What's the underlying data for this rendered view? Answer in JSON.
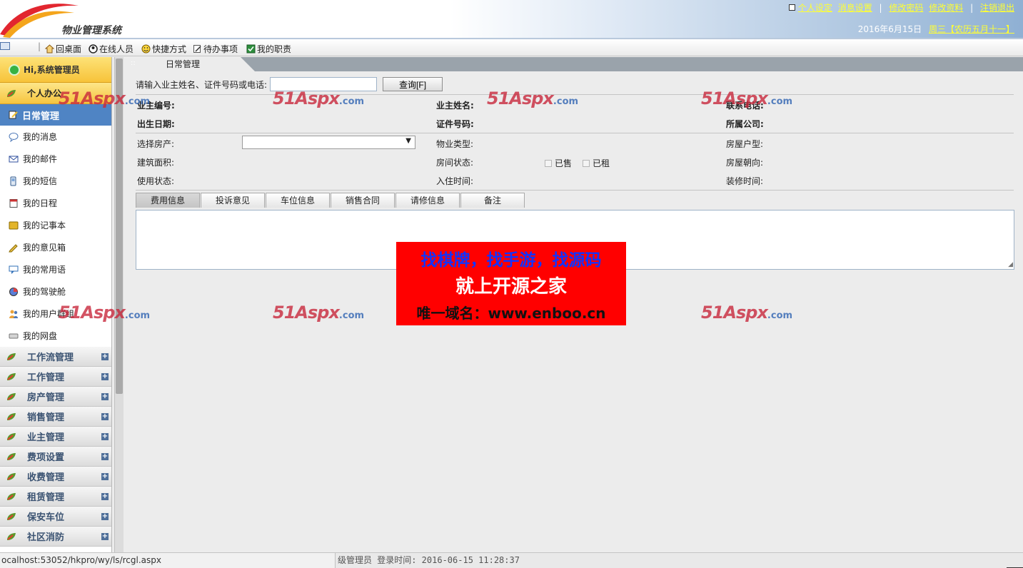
{
  "header": {
    "app_title": "物业管理系统",
    "links": [
      "个人设定",
      "消息设置",
      "修改密码",
      "修改资料",
      "注销退出"
    ],
    "date_text": "2016年6月15日",
    "weekday_text": "周三【农历五月十一】"
  },
  "toolbar": {
    "items": [
      "回桌面",
      "在线人员",
      "快捷方式",
      "待办事项",
      "我的职责"
    ]
  },
  "sidebar": {
    "greeting": "Hi,系统管理员",
    "personal_section": "个人办公",
    "active_item": "日常管理",
    "items": [
      "我的消息",
      "我的邮件",
      "我的短信",
      "我的日程",
      "我的记事本",
      "我的意见箱",
      "我的常用语",
      "我的驾驶舱",
      "我的用户群组",
      "我的网盘"
    ],
    "groups": [
      "工作流管理",
      "工作管理",
      "房产管理",
      "销售管理",
      "业主管理",
      "费项设置",
      "收费管理",
      "租赁管理",
      "保安车位",
      "社区消防"
    ]
  },
  "content": {
    "tab_title": "日常管理",
    "search": {
      "label": "请输入业主姓名、证件号码或电话:",
      "value": "",
      "button": "查询[F]"
    },
    "labels": {
      "owner_no": "业主编号:",
      "owner_name": "业主姓名:",
      "phone": "联系电话:",
      "birthdate": "出生日期:",
      "id_no": "证件号码:",
      "company": "所属公司:",
      "select_property": "选择房产:",
      "property_type": "物业类型:",
      "house_type": "房屋户型:",
      "area": "建筑面积:",
      "room_status": "房间状态:",
      "sold": "已售",
      "rented": "已租",
      "orientation": "房屋朝向:",
      "usage_status": "使用状态:",
      "checkin_time": "入住时间:",
      "decoration_time": "装修时间:"
    },
    "tabs": [
      "费用信息",
      "投诉意见",
      "车位信息",
      "销售合同",
      "请修信息",
      "备注"
    ],
    "active_tab": "费用信息"
  },
  "ad": {
    "line1": "找棋牌，找手游，找源码",
    "line2": "就上开源之家",
    "line3": "唯一域名：www.enboo.cn"
  },
  "watermark": {
    "main": "51Aspx",
    "suffix": ".com"
  },
  "status": {
    "url": "ocalhost:53052/hkpro/wy/ls/rcgl.aspx",
    "info": "级管理员  登录时间: 2016-06-15 11:28:37"
  },
  "colors": {
    "sidebar_active": "#4f84c4",
    "header_link": "#ffff33",
    "ad_background": "#ff0000"
  }
}
